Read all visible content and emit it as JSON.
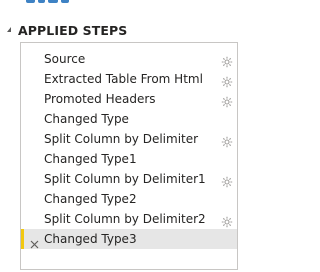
{
  "panel": {
    "title": "APPLIED STEPS"
  },
  "steps": [
    {
      "label": "Source",
      "has_settings": true
    },
    {
      "label": "Extracted Table From Html",
      "has_settings": true
    },
    {
      "label": "Promoted Headers",
      "has_settings": true
    },
    {
      "label": "Changed Type",
      "has_settings": false
    },
    {
      "label": "Split Column by Delimiter",
      "has_settings": true
    },
    {
      "label": "Changed Type1",
      "has_settings": false
    },
    {
      "label": "Split Column by Delimiter1",
      "has_settings": true
    },
    {
      "label": "Changed Type2",
      "has_settings": false
    },
    {
      "label": "Split Column by Delimiter2",
      "has_settings": true
    },
    {
      "label": "Changed Type3",
      "has_settings": false,
      "selected": true
    }
  ],
  "colors": {
    "accent": "#f2c811",
    "selected_bg": "#e6e6e6",
    "border": "#c8c6c4",
    "text": "#252423",
    "icon": "#a19f9d"
  },
  "icons": {
    "collapse": "triangle-collapse-icon",
    "settings": "gear-icon",
    "delete": "delete-x-icon"
  }
}
